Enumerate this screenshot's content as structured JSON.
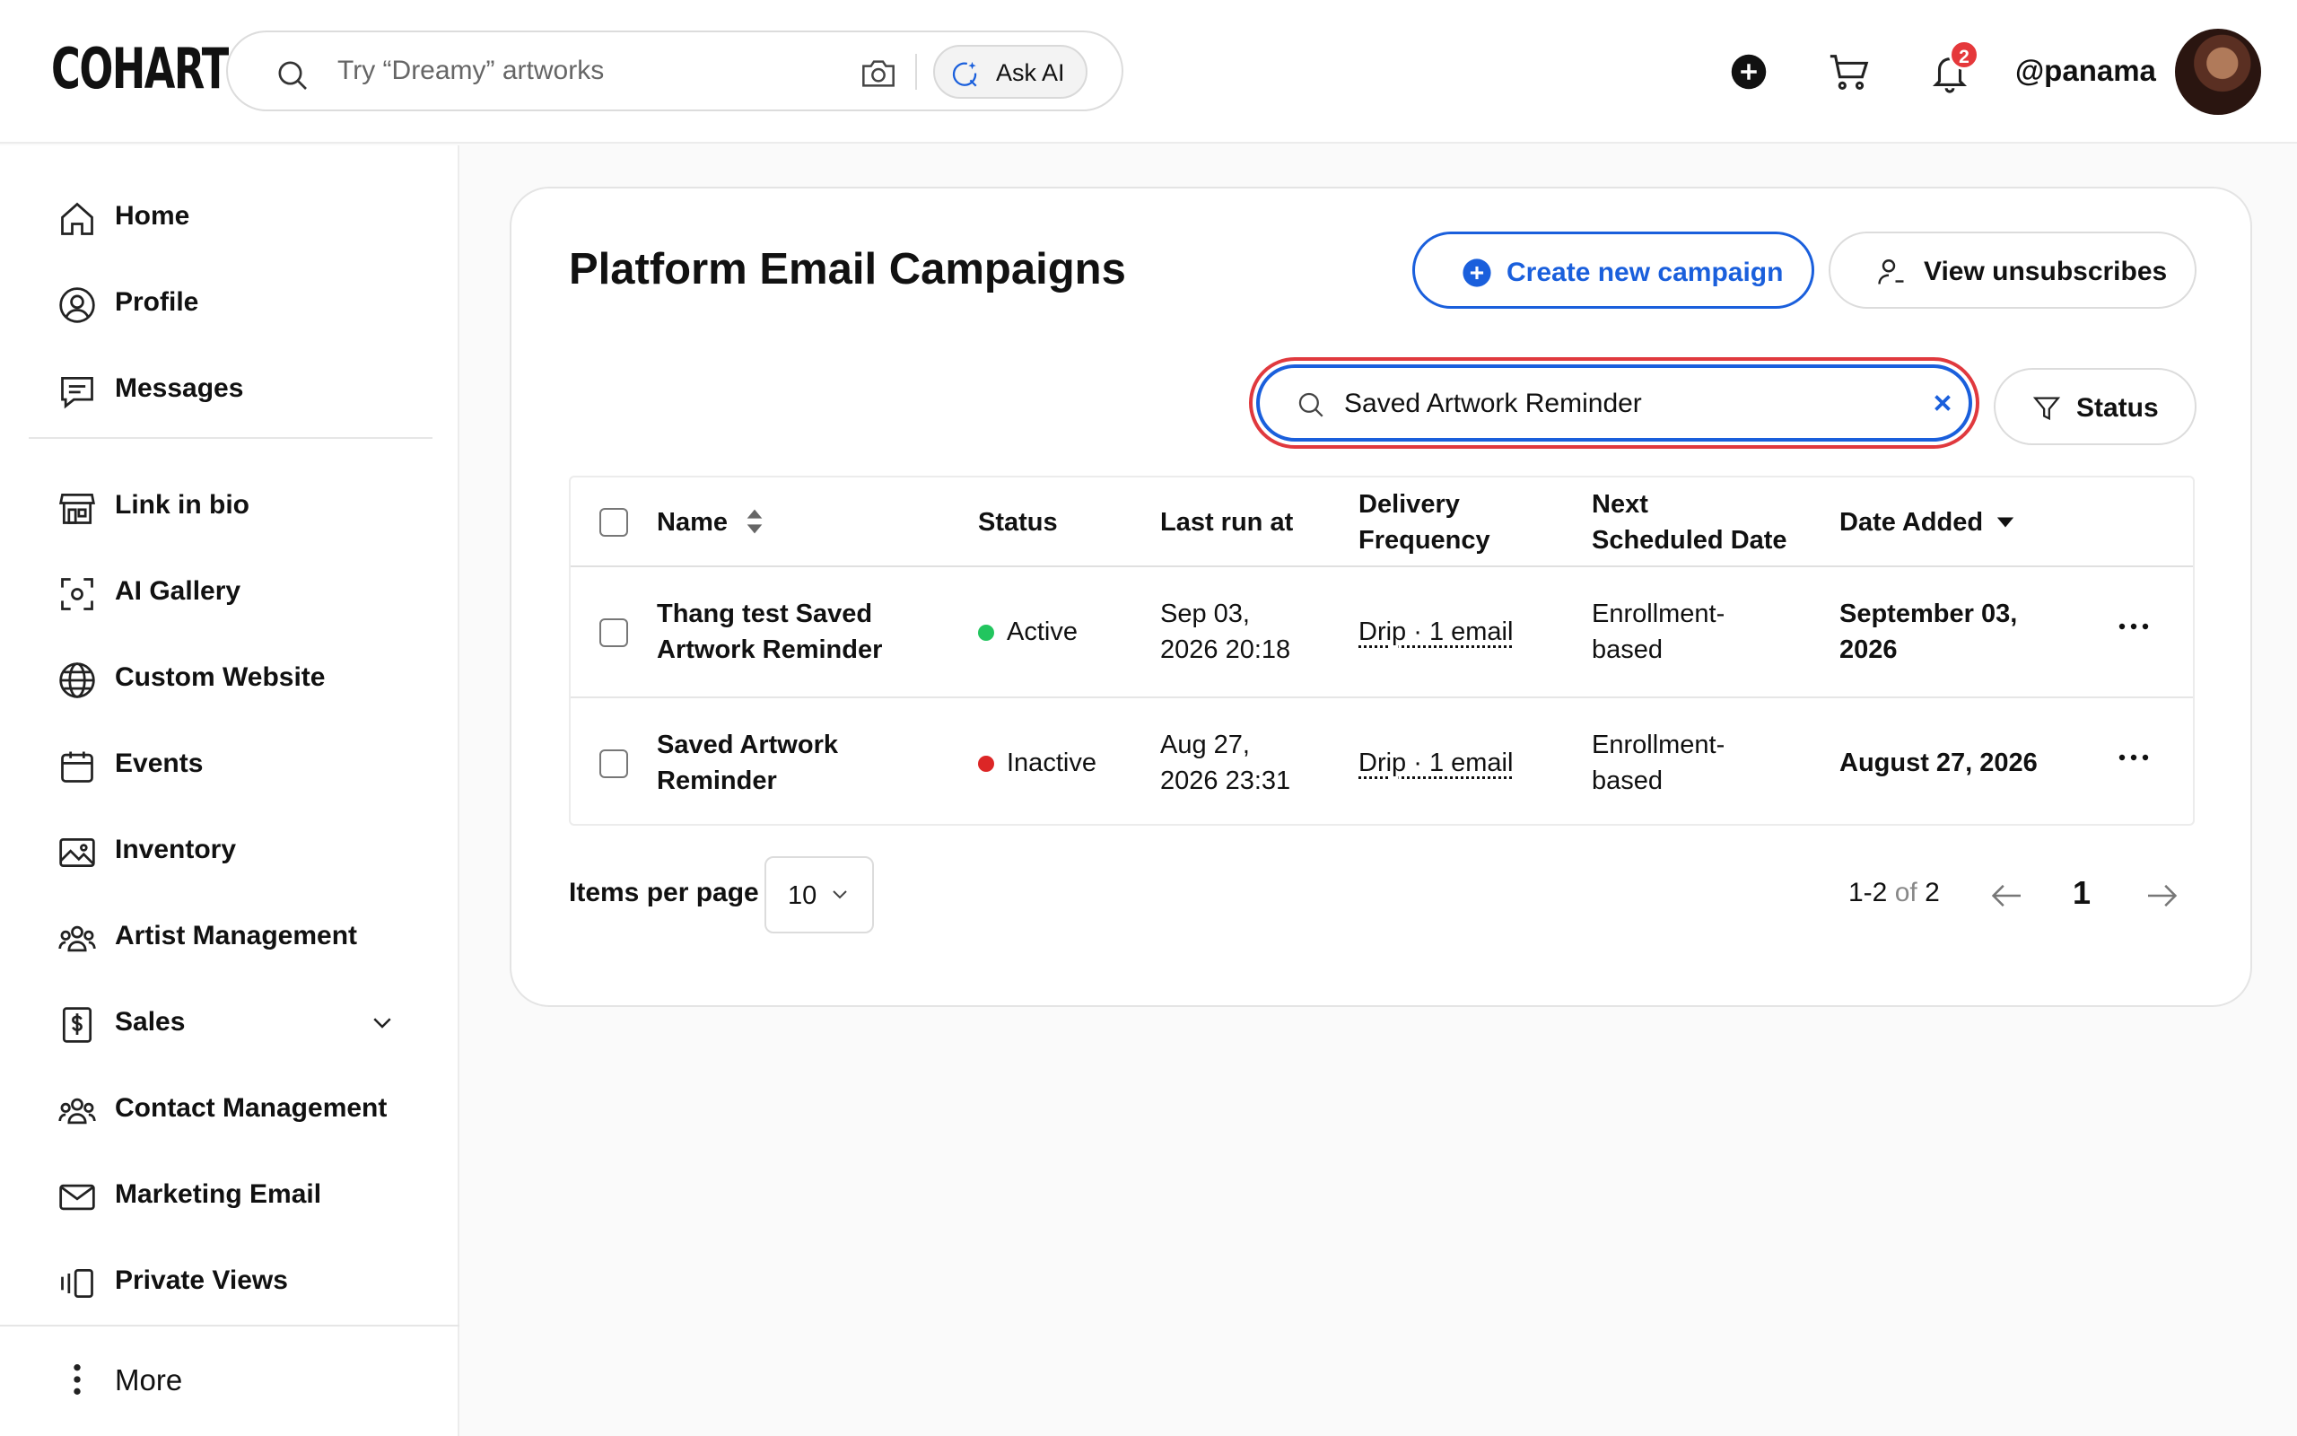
{
  "header": {
    "logo": "COHART",
    "search_placeholder": "Try “Dreamy” artworks",
    "ask_ai_label": "Ask AI",
    "notification_count": "2",
    "username": "@panama"
  },
  "sidebar": {
    "items": [
      {
        "label": "Home",
        "icon": "home-icon"
      },
      {
        "label": "Profile",
        "icon": "profile-icon"
      },
      {
        "label": "Messages",
        "icon": "messages-icon"
      },
      {
        "label": "Link in bio",
        "icon": "storefront-icon"
      },
      {
        "label": "AI Gallery",
        "icon": "ai-scan-icon"
      },
      {
        "label": "Custom Website",
        "icon": "globe-icon"
      },
      {
        "label": "Events",
        "icon": "calendar-icon"
      },
      {
        "label": "Inventory",
        "icon": "image-icon"
      },
      {
        "label": "Artist Management",
        "icon": "group-icon"
      },
      {
        "label": "Sales",
        "icon": "dollar-doc-icon"
      },
      {
        "label": "Contact Management",
        "icon": "group-icon"
      },
      {
        "label": "Marketing Email",
        "icon": "mail-icon"
      },
      {
        "label": "Private Views",
        "icon": "slides-icon"
      }
    ],
    "more_label": "More"
  },
  "main": {
    "title": "Platform Email Campaigns",
    "create_button": "Create new campaign",
    "unsubscribes_button": "View unsubscribes",
    "filter_value": "Saved Artwork Reminder",
    "status_filter": "Status",
    "table": {
      "headers": {
        "name": "Name",
        "status": "Status",
        "last_run": "Last run at",
        "delivery_1": "Delivery",
        "delivery_2": "Frequency",
        "next_1": "Next",
        "next_2": "Scheduled Date",
        "date_added": "Date Added"
      },
      "rows": [
        {
          "name_1": "Thang test Saved",
          "name_2": "Artwork Reminder",
          "status": "Active",
          "status_color": "#22c55e",
          "last_run_1": "Sep 03,",
          "last_run_2": "2026 20:18",
          "delivery": "Drip · 1 email",
          "next_1": "Enrollment-",
          "next_2": "based",
          "date_added_1": "September 03,",
          "date_added_2": "2026"
        },
        {
          "name_1": "Saved Artwork",
          "name_2": "Reminder",
          "status": "Inactive",
          "status_color": "#dc2626",
          "last_run_1": "Aug 27,",
          "last_run_2": "2026 23:31",
          "delivery": "Drip · 1 email",
          "next_1": "Enrollment-",
          "next_2": "based",
          "date_added_1": "August 27, 2026",
          "date_added_2": ""
        }
      ]
    },
    "pagination": {
      "items_per_page_label": "Items per page",
      "items_per_page_value": "10",
      "range": "1-2",
      "of_label": "of",
      "total": "2",
      "current_page": "1"
    }
  },
  "colors": {
    "accent": "#1a5fdc",
    "focus_ring": "#e0393e",
    "badge": "#e5383b"
  }
}
